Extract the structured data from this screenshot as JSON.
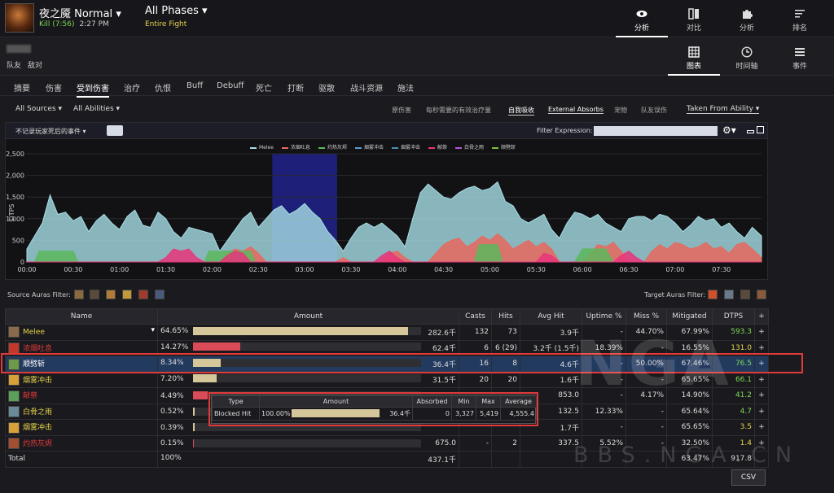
{
  "boss": {
    "name": "夜之魇 Normal",
    "result": "Kill (7:56)",
    "time": "2:27 PM"
  },
  "phase": {
    "title": "All Phases",
    "sub": "Entire Fight"
  },
  "topnav": [
    {
      "label": "分析",
      "icon": "eye-icon",
      "active": true
    },
    {
      "label": "对比",
      "icon": "compare-icon",
      "active": false
    },
    {
      "label": "分析",
      "icon": "puzzle-icon",
      "active": false
    },
    {
      "label": "排名",
      "icon": "rankings-icon",
      "active": false
    }
  ],
  "viewnav": [
    {
      "label": "图表",
      "icon": "grid-icon",
      "active": true
    },
    {
      "label": "时间轴",
      "icon": "clock-icon",
      "active": false
    },
    {
      "label": "事件",
      "icon": "list-icon",
      "active": false
    }
  ],
  "team": {
    "friendly": "队友",
    "enemy": "敌对"
  },
  "tabs": [
    "摘要",
    "伤害",
    "受到伤害",
    "治疗",
    "仇恨",
    "Buff",
    "Debuff",
    "死亡",
    "打断",
    "驱散",
    "战斗资源",
    "施法"
  ],
  "active_tab": "受到伤害",
  "filters": {
    "sources": "All Sources",
    "abilities": "All Abilities",
    "options": [
      "原伤害",
      "每秒需要的有效治疗量",
      "自我吸收",
      "External Absorbs",
      "宠物",
      "队友误伤"
    ],
    "taken_from": "Taken From Ability"
  },
  "chart_toolbar": {
    "left_label": "不记录玩家死后的事件",
    "filter_label": "Filter Expression:",
    "filter_value": ""
  },
  "chart_data": {
    "type": "area",
    "ylabel": "DTPS",
    "ylim": [
      0,
      2500
    ],
    "yticks": [
      "0",
      "500",
      "1,000",
      "1,500",
      "2,000",
      "2,500"
    ],
    "xticks": [
      "00:00",
      "00:30",
      "01:00",
      "01:30",
      "02:00",
      "02:30",
      "03:00",
      "03:30",
      "04:00",
      "04:30",
      "05:00",
      "05:30",
      "06:00",
      "06:30",
      "07:00",
      "07:30"
    ],
    "x_seconds_max": 476,
    "highlight_seconds": [
      159,
      201
    ],
    "legend_position": "top",
    "series": [
      {
        "name": "Melee",
        "color": "#a8dfe6",
        "points": [
          [
            0,
            300
          ],
          [
            10,
            900
          ],
          [
            15,
            1550
          ],
          [
            20,
            1100
          ],
          [
            25,
            1150
          ],
          [
            30,
            950
          ],
          [
            35,
            1050
          ],
          [
            40,
            700
          ],
          [
            45,
            950
          ],
          [
            50,
            1100
          ],
          [
            55,
            900
          ],
          [
            60,
            750
          ],
          [
            65,
            1050
          ],
          [
            70,
            1200
          ],
          [
            75,
            850
          ],
          [
            80,
            800
          ],
          [
            85,
            1150
          ],
          [
            90,
            1000
          ],
          [
            95,
            700
          ],
          [
            100,
            550
          ],
          [
            105,
            800
          ],
          [
            110,
            750
          ],
          [
            115,
            700
          ],
          [
            120,
            650
          ],
          [
            125,
            250
          ],
          [
            130,
            500
          ],
          [
            135,
            750
          ],
          [
            140,
            1000
          ],
          [
            145,
            1150
          ],
          [
            150,
            800
          ],
          [
            155,
            1000
          ],
          [
            160,
            1200
          ],
          [
            165,
            1300
          ],
          [
            170,
            1100
          ],
          [
            175,
            1200
          ],
          [
            180,
            1350
          ],
          [
            185,
            1150
          ],
          [
            190,
            1000
          ],
          [
            195,
            700
          ],
          [
            200,
            500
          ],
          [
            205,
            250
          ],
          [
            210,
            550
          ],
          [
            215,
            800
          ],
          [
            220,
            900
          ],
          [
            225,
            800
          ],
          [
            230,
            900
          ],
          [
            235,
            750
          ],
          [
            240,
            600
          ],
          [
            245,
            350
          ],
          [
            250,
            1000
          ],
          [
            255,
            1600
          ],
          [
            260,
            1800
          ],
          [
            265,
            1650
          ],
          [
            270,
            1500
          ],
          [
            275,
            1450
          ],
          [
            280,
            1600
          ],
          [
            285,
            1700
          ],
          [
            290,
            1750
          ],
          [
            295,
            1650
          ],
          [
            300,
            1700
          ],
          [
            305,
            1850
          ],
          [
            310,
            1400
          ],
          [
            315,
            1300
          ],
          [
            320,
            1000
          ],
          [
            325,
            900
          ],
          [
            330,
            1000
          ],
          [
            335,
            1100
          ],
          [
            340,
            750
          ],
          [
            345,
            550
          ],
          [
            350,
            900
          ],
          [
            355,
            1150
          ],
          [
            360,
            1100
          ],
          [
            365,
            1000
          ],
          [
            370,
            1100
          ],
          [
            375,
            900
          ],
          [
            380,
            800
          ],
          [
            385,
            700
          ],
          [
            390,
            1000
          ],
          [
            395,
            1050
          ],
          [
            400,
            1050
          ],
          [
            405,
            950
          ],
          [
            410,
            1100
          ],
          [
            415,
            1050
          ],
          [
            420,
            900
          ],
          [
            425,
            700
          ],
          [
            430,
            850
          ],
          [
            435,
            1050
          ],
          [
            440,
            950
          ],
          [
            445,
            1000
          ],
          [
            450,
            800
          ],
          [
            455,
            900
          ],
          [
            460,
            700
          ],
          [
            465,
            550
          ],
          [
            470,
            800
          ],
          [
            476,
            600
          ]
        ]
      },
      {
        "name": "浓烟吐息",
        "color": "#e8695e",
        "points": [
          [
            0,
            0
          ],
          [
            125,
            0
          ],
          [
            130,
            200
          ],
          [
            135,
            300
          ],
          [
            140,
            250
          ],
          [
            145,
            350
          ],
          [
            150,
            200
          ],
          [
            155,
            0
          ],
          [
            200,
            0
          ],
          [
            205,
            100
          ],
          [
            210,
            0
          ],
          [
            230,
            0
          ],
          [
            235,
            200
          ],
          [
            240,
            250
          ],
          [
            245,
            100
          ],
          [
            250,
            0
          ],
          [
            260,
            0
          ],
          [
            265,
            200
          ],
          [
            270,
            400
          ],
          [
            275,
            500
          ],
          [
            280,
            550
          ],
          [
            285,
            350
          ],
          [
            290,
            450
          ],
          [
            295,
            600
          ],
          [
            300,
            500
          ],
          [
            305,
            650
          ],
          [
            310,
            500
          ],
          [
            315,
            300
          ],
          [
            320,
            400
          ],
          [
            325,
            500
          ],
          [
            330,
            350
          ],
          [
            335,
            450
          ],
          [
            340,
            300
          ],
          [
            345,
            0
          ],
          [
            360,
            0
          ],
          [
            365,
            200
          ],
          [
            370,
            400
          ],
          [
            375,
            350
          ],
          [
            380,
            450
          ],
          [
            385,
            250
          ],
          [
            390,
            0
          ],
          [
            400,
            0
          ],
          [
            405,
            250
          ],
          [
            410,
            400
          ],
          [
            415,
            300
          ],
          [
            420,
            450
          ],
          [
            425,
            400
          ],
          [
            430,
            300
          ],
          [
            435,
            350
          ],
          [
            440,
            450
          ],
          [
            445,
            300
          ],
          [
            450,
            350
          ],
          [
            455,
            200
          ],
          [
            460,
            400
          ],
          [
            465,
            450
          ],
          [
            470,
            300
          ],
          [
            476,
            100
          ]
        ]
      },
      {
        "name": "灼热灰烬",
        "color": "#5cb85c",
        "points": [
          [
            0,
            0
          ],
          [
            5,
            0
          ],
          [
            8,
            250
          ],
          [
            30,
            250
          ],
          [
            33,
            0
          ],
          [
            115,
            0
          ],
          [
            118,
            250
          ],
          [
            145,
            250
          ],
          [
            148,
            0
          ],
          [
            290,
            0
          ],
          [
            293,
            400
          ],
          [
            305,
            400
          ],
          [
            308,
            0
          ],
          [
            355,
            0
          ],
          [
            360,
            300
          ],
          [
            375,
            300
          ],
          [
            380,
            0
          ],
          [
            476,
            0
          ]
        ]
      },
      {
        "name": "烟雾冲击",
        "color": "#5b9bd5",
        "points": [
          [
            0,
            0
          ],
          [
            476,
            0
          ]
        ]
      },
      {
        "name": "烟雾冲击",
        "color": "#4a8fb0",
        "points": [
          [
            0,
            0
          ],
          [
            476,
            0
          ]
        ]
      },
      {
        "name": "献祭",
        "color": "#e8357a",
        "points": [
          [
            0,
            0
          ],
          [
            85,
            0
          ],
          [
            90,
            100
          ],
          [
            95,
            300
          ],
          [
            100,
            250
          ],
          [
            105,
            300
          ],
          [
            110,
            100
          ],
          [
            115,
            0
          ],
          [
            125,
            0
          ],
          [
            130,
            150
          ],
          [
            135,
            250
          ],
          [
            140,
            200
          ],
          [
            145,
            0
          ],
          [
            225,
            0
          ],
          [
            230,
            150
          ],
          [
            235,
            250
          ],
          [
            240,
            100
          ],
          [
            245,
            0
          ],
          [
            330,
            0
          ],
          [
            335,
            200
          ],
          [
            340,
            150
          ],
          [
            345,
            0
          ],
          [
            380,
            0
          ],
          [
            385,
            150
          ],
          [
            390,
            250
          ],
          [
            395,
            100
          ],
          [
            400,
            0
          ],
          [
            476,
            0
          ]
        ]
      },
      {
        "name": "白骨之雨",
        "color": "#b05cd8",
        "points": [
          [
            0,
            0
          ],
          [
            476,
            0
          ]
        ]
      },
      {
        "name": "顺劈斩",
        "color": "#7fbf3f",
        "points": [
          [
            0,
            0
          ],
          [
            476,
            0
          ]
        ]
      }
    ]
  },
  "auras": {
    "source_label": "Source Auras Filter:",
    "target_label": "Target Auras Filter:"
  },
  "table": {
    "headers": [
      "Name",
      "Amount",
      "Casts",
      "Hits",
      "Avg Hit",
      "Uptime %",
      "Miss %",
      "Mitigated",
      "DTPS",
      "+"
    ],
    "rows": [
      {
        "name": "Melee",
        "color": "#e6d34a",
        "icon_color": "#8a6a4a",
        "pct": "64.65%",
        "fraction": 0.6465,
        "bar_color": "#d6c79a",
        "amount": "282.6千",
        "casts": "132",
        "hits": "73",
        "avg": "3.9千",
        "uptime": "-",
        "miss": "44.70%",
        "mitigated": "67.99%",
        "dtps": "593.3",
        "dtps_color": "#7ed957",
        "dropdown": true
      },
      {
        "name": "浓烟吐息",
        "color": "#e23a3a",
        "icon_color": "#c0392b",
        "pct": "14.27%",
        "fraction": 0.1427,
        "bar_color": "#d94b57",
        "amount": "62.4千",
        "casts": "6",
        "hits": "6 (29)",
        "avg": "3.2千 (1.5千)",
        "uptime": "18.39%",
        "miss": "-",
        "mitigated": "16.55%",
        "dtps": "131.0",
        "dtps_color": "#e6d34a"
      },
      {
        "name": "顺劈斩",
        "color": "#ffffff",
        "icon_color": "#6a9a4a",
        "pct": "8.34%",
        "fraction": 0.0834,
        "bar_color": "#d6c79a",
        "amount": "36.4千",
        "casts": "16",
        "hits": "8",
        "avg": "4.6千",
        "uptime": "-",
        "miss": "50.00%",
        "mitigated": "67.46%",
        "dtps": "76.5",
        "dtps_color": "#7ed957",
        "highlight": true
      },
      {
        "name": "烟雾冲击",
        "color": "#e6d34a",
        "icon_color": "#d9a03a",
        "pct": "7.20%",
        "fraction": 0.072,
        "bar_color": "#d6c79a",
        "amount": "31.5千",
        "casts": "20",
        "hits": "20",
        "avg": "1.6千",
        "uptime": "-",
        "miss": "-",
        "mitigated": "65.65%",
        "dtps": "66.1",
        "dtps_color": "#7ed957"
      },
      {
        "name": "献祭",
        "color": "#e23a3a",
        "icon_color": "#5aa05a",
        "pct": "4.49%",
        "fraction": 0.0449,
        "bar_color": "#d94b57",
        "amount": "",
        "casts": "",
        "hits": "",
        "avg": "853.0",
        "uptime": "-",
        "miss": "4.17%",
        "mitigated": "14.90%",
        "dtps": "41.2",
        "dtps_color": "#7ed957"
      },
      {
        "name": "白骨之雨",
        "color": "#e6d34a",
        "icon_color": "#6a8a9a",
        "pct": "0.52%",
        "fraction": 0.0052,
        "bar_color": "#d6c79a",
        "amount": "",
        "casts": "",
        "hits": "",
        "avg": "132.5",
        "uptime": "12.33%",
        "miss": "-",
        "mitigated": "65.64%",
        "dtps": "4.7",
        "dtps_color": "#7ed957"
      },
      {
        "name": "烟雾冲击",
        "color": "#e6d34a",
        "icon_color": "#d9a03a",
        "pct": "0.39%",
        "fraction": 0.0039,
        "bar_color": "#d6c79a",
        "amount": "",
        "casts": "",
        "hits": "",
        "avg": "1.7千",
        "uptime": "-",
        "miss": "-",
        "mitigated": "65.65%",
        "dtps": "3.5",
        "dtps_color": "#e6d34a"
      },
      {
        "name": "灼热灰烬",
        "color": "#e23a3a",
        "icon_color": "#a05030",
        "pct": "0.15%",
        "fraction": 0.0015,
        "bar_color": "#d94b57",
        "amount": "675.0",
        "casts": "-",
        "hits": "2",
        "avg": "337.5",
        "uptime": "5.52%",
        "miss": "-",
        "mitigated": "32.50%",
        "dtps": "1.4",
        "dtps_color": "#e6d34a"
      }
    ],
    "total": {
      "name": "Total",
      "pct": "100%",
      "amount": "437.1千",
      "mitigated": "63.47%",
      "dtps": "917.8"
    }
  },
  "popup": {
    "headers": [
      "Type",
      "Amount",
      "Absorbed",
      "Min",
      "Max",
      "Average"
    ],
    "row": {
      "type": "Blocked Hit",
      "pct": "100.00%",
      "fraction": 1.0,
      "amount": "36.4千",
      "absorbed": "0",
      "min": "3,327",
      "max": "5,419",
      "average": "4,555.4"
    }
  },
  "csv_label": "CSV",
  "watermark": {
    "logo": "NGA",
    "site": "BBS.NGA.CN"
  }
}
